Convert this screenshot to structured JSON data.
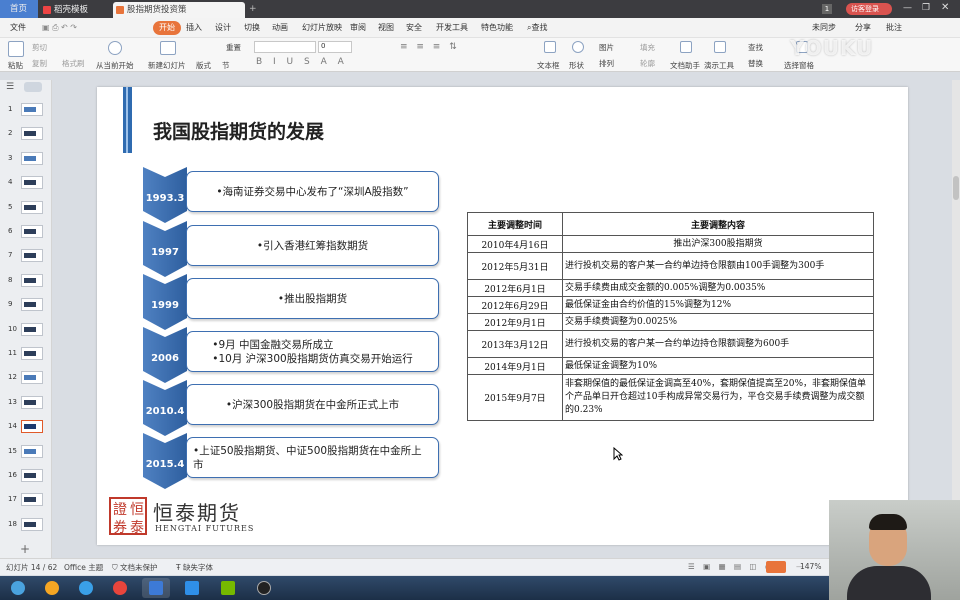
{
  "tabs": [
    {
      "label": "首页"
    },
    {
      "label": "稻壳模板"
    },
    {
      "label": "股指期货投资策略...20200310"
    }
  ],
  "window": {
    "page_count_badge": "1",
    "login_label": "访客登录"
  },
  "menu": {
    "file": "文件",
    "items": [
      "开始",
      "插入",
      "设计",
      "切换",
      "动画",
      "幻灯片放映",
      "审阅",
      "视图",
      "安全",
      "开发工具",
      "特色功能"
    ],
    "search": "查找",
    "right": [
      "未同步",
      "分享",
      "批注"
    ]
  },
  "ribbon": {
    "paste": "粘贴",
    "cut": "剪切",
    "copy": "复制",
    "format_painter": "格式刷",
    "from_current": "从当前开始",
    "new_slide": "新建幻灯片",
    "layout": "版式",
    "section": "节",
    "reset": "重置",
    "font_size": "0",
    "textbox": "文本框",
    "shape": "形状",
    "arrange": "排列",
    "picture": "图片",
    "fill": "填充",
    "outline": "轮廓",
    "find": "查找",
    "replace": "替换",
    "doc_helper": "文档助手",
    "presenter": "演示工具",
    "select_pane": "选择窗格"
  },
  "thumbnails": [
    "1",
    "2",
    "3",
    "4",
    "5",
    "6",
    "7",
    "8",
    "9",
    "10",
    "11",
    "12",
    "13",
    "14",
    "15",
    "16",
    "17",
    "18"
  ],
  "selected_thumbnail": "14",
  "slide": {
    "title": "我国股指期货的发展",
    "timeline": [
      {
        "year": "1993.3",
        "text": "•海南证券交易中心发布了“深圳A股指数”"
      },
      {
        "year": "1997",
        "text": "•引入香港红筹指数期货"
      },
      {
        "year": "1999",
        "text": "•推出股指期货"
      },
      {
        "year": "2006",
        "text": "•9月 中国金融交易所成立\n•10月 沪深300股指期货仿真交易开始运行"
      },
      {
        "year": "2010.4",
        "text": "•沪深300股指期货在中金所正式上市"
      },
      {
        "year": "2015.4",
        "text": "•上证50股指期货、中证500股指期货在中金所上市"
      }
    ],
    "table": {
      "headers": [
        "主要调整时间",
        "主要调整内容"
      ],
      "rows": [
        {
          "date": "2010年4月16日",
          "content": "推出沪深300股指期货",
          "center": true
        },
        {
          "date": "2012年5月31日",
          "content": "进行投机交易的客户某一合约单边持仓限额由100手调整为300手"
        },
        {
          "date": "2012年6月1日",
          "content": "交易手续费由成交金额的0.005%调整为0.0035%"
        },
        {
          "date": "2012年6月29日",
          "content": "最低保证金由合约价值的15%调整为12%"
        },
        {
          "date": "2012年9月1日",
          "content": "交易手续费调整为0.0025%"
        },
        {
          "date": "2013年3月12日",
          "content": "进行投机交易的客户某一合约单边持仓限额调整为600手"
        },
        {
          "date": "2014年9月1日",
          "content": "最低保证金调整为10%"
        },
        {
          "date": "2015年9月7日",
          "content": "非套期保值的最低保证金调高至40%，套期保值提高至20%，非套期保值单个产品单日开仓超过10手构成异常交易行为，平仓交易手续费调整为成交额的0.23%"
        }
      ]
    },
    "logo": {
      "mark": [
        "證",
        "恒",
        "券",
        "泰"
      ],
      "cn": "恒泰期货",
      "en": "HENGTAI FUTURES"
    }
  },
  "status": {
    "slide_pos": "幻灯片 14 / 62",
    "theme": "Office 主题",
    "protect": "文档未保护",
    "missing_font": "缺失字体",
    "zoom": "147%"
  },
  "watermark": "YOUKU",
  "colors": {
    "accent": "#e8743b",
    "chevron": "#3e6fb1",
    "box_border": "#3e6fb1",
    "title_bar": "#2f6bb0"
  }
}
